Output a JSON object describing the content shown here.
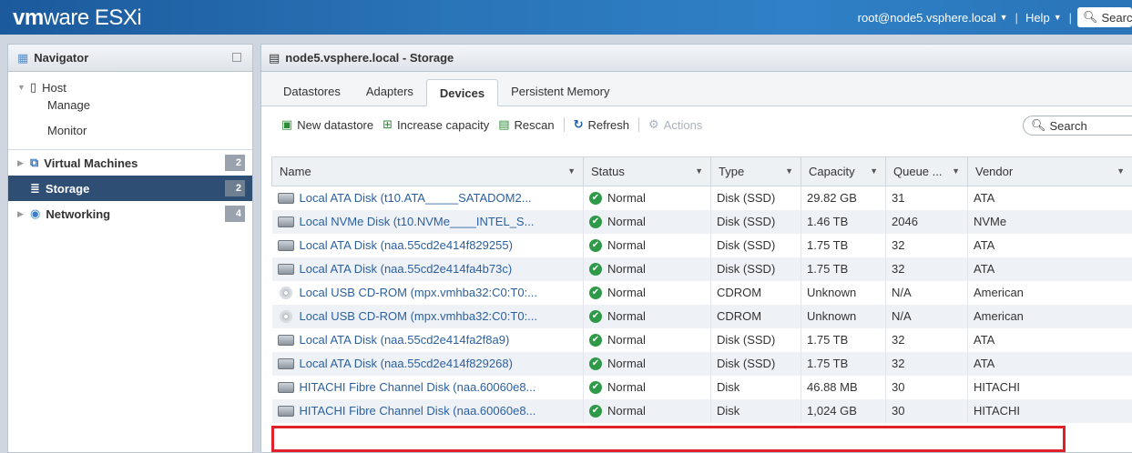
{
  "topbar": {
    "brand_vm": "vm",
    "brand_rest": "ware",
    "brand_product": " ESXi",
    "user": "root@node5.vsphere.local",
    "help": "Help",
    "separator": "|",
    "search_placeholder": "Search"
  },
  "navigator": {
    "title": "Navigator",
    "host_label": "Host",
    "host_items": [
      "Manage",
      "Monitor"
    ],
    "items": [
      {
        "label": "Virtual Machines",
        "count": "2"
      },
      {
        "label": "Storage",
        "count": "2"
      },
      {
        "label": "Networking",
        "count": "4"
      }
    ]
  },
  "main": {
    "title": "node5.vsphere.local - Storage",
    "tabs": [
      "Datastores",
      "Adapters",
      "Devices",
      "Persistent Memory"
    ],
    "active_tab": "Devices",
    "toolbar": {
      "new_datastore": "New datastore",
      "increase_capacity": "Increase capacity",
      "rescan": "Rescan",
      "refresh": "Refresh",
      "actions": "Actions",
      "search_placeholder": "Search"
    },
    "columns": [
      "Name",
      "Status",
      "Type",
      "Capacity",
      "Queue ...",
      "Vendor"
    ],
    "rows": [
      {
        "icon": "disk-icon",
        "name": "Local ATA Disk (t10.ATA_____SATADOM2...",
        "status": "Normal",
        "type": "Disk (SSD)",
        "capacity": "29.82 GB",
        "queue": "31",
        "vendor": "ATA"
      },
      {
        "icon": "disk-icon",
        "name": "Local NVMe Disk (t10.NVMe____INTEL_S...",
        "status": "Normal",
        "type": "Disk (SSD)",
        "capacity": "1.46 TB",
        "queue": "2046",
        "vendor": "NVMe"
      },
      {
        "icon": "disk-icon",
        "name": "Local ATA Disk (naa.55cd2e414f829255)",
        "status": "Normal",
        "type": "Disk (SSD)",
        "capacity": "1.75 TB",
        "queue": "32",
        "vendor": "ATA"
      },
      {
        "icon": "disk-icon",
        "name": "Local ATA Disk (naa.55cd2e414fa4b73c)",
        "status": "Normal",
        "type": "Disk (SSD)",
        "capacity": "1.75 TB",
        "queue": "32",
        "vendor": "ATA"
      },
      {
        "icon": "cdrom-icon",
        "name": "Local USB CD-ROM (mpx.vmhba32:C0:T0:...",
        "status": "Normal",
        "type": "CDROM",
        "capacity": "Unknown",
        "queue": "N/A",
        "vendor": "American"
      },
      {
        "icon": "cdrom-icon",
        "name": "Local USB CD-ROM (mpx.vmhba32:C0:T0:...",
        "status": "Normal",
        "type": "CDROM",
        "capacity": "Unknown",
        "queue": "N/A",
        "vendor": "American"
      },
      {
        "icon": "disk-icon",
        "name": "Local ATA Disk (naa.55cd2e414fa2f8a9)",
        "status": "Normal",
        "type": "Disk (SSD)",
        "capacity": "1.75 TB",
        "queue": "32",
        "vendor": "ATA"
      },
      {
        "icon": "disk-icon",
        "name": "Local ATA Disk (naa.55cd2e414f829268)",
        "status": "Normal",
        "type": "Disk (SSD)",
        "capacity": "1.75 TB",
        "queue": "32",
        "vendor": "ATA"
      },
      {
        "icon": "disk-icon",
        "name": "HITACHI Fibre Channel Disk (naa.60060e8...",
        "status": "Normal",
        "type": "Disk",
        "capacity": "46.88 MB",
        "queue": "30",
        "vendor": "HITACHI"
      },
      {
        "icon": "disk-icon",
        "name": "HITACHI Fibre Channel Disk (naa.60060e8...",
        "status": "Normal",
        "type": "Disk",
        "capacity": "1,024 GB",
        "queue": "30",
        "vendor": "HITACHI"
      }
    ],
    "highlight_color": "#e0202a"
  }
}
